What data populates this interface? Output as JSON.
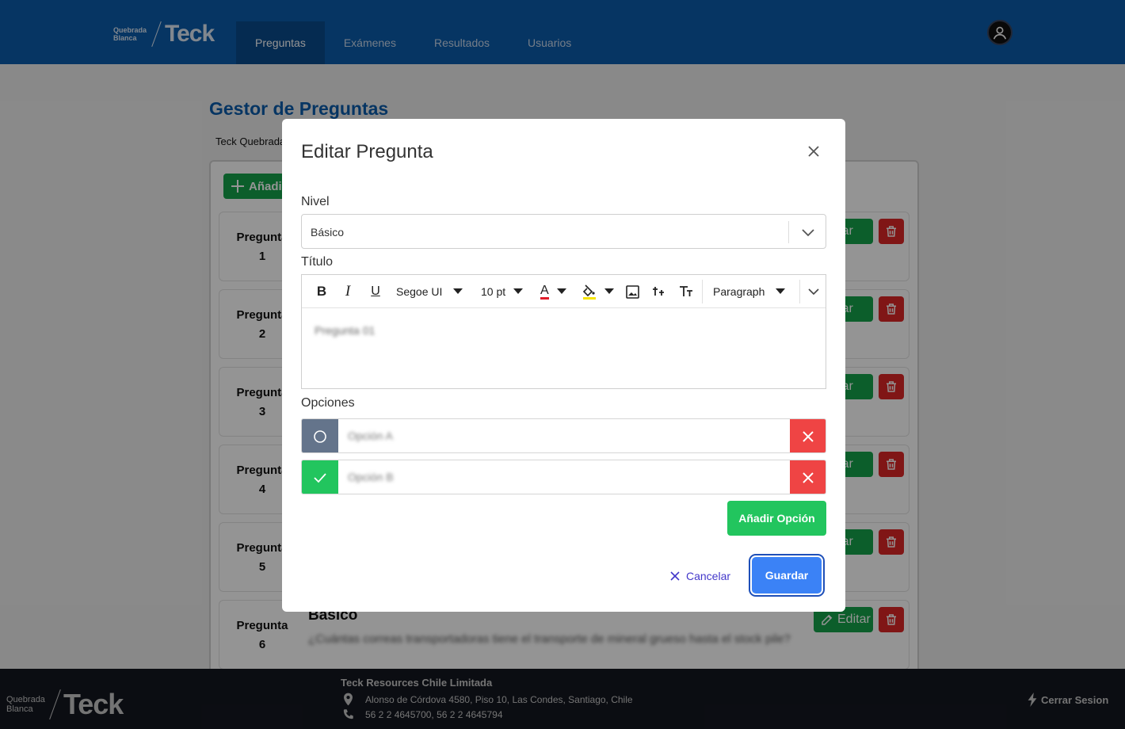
{
  "nav": {
    "brand_small_1": "Quebrada",
    "brand_small_2": "Blanca",
    "brand_name": "Teck",
    "tabs": [
      {
        "label": "Preguntas"
      },
      {
        "label": "Exámenes"
      },
      {
        "label": "Resultados"
      },
      {
        "label": "Usuarios"
      }
    ]
  },
  "page": {
    "title": "Gestor de Preguntas",
    "org_label": "Teck Quebrada",
    "add_button": "Añadir",
    "question_label": "Pregunta",
    "edit_label": "Editar",
    "questions": [
      {
        "num": "1"
      },
      {
        "num": "2"
      },
      {
        "num": "3"
      },
      {
        "num": "4"
      },
      {
        "num": "5"
      },
      {
        "num": "6",
        "level": "Básico",
        "text": "¿Cuántas correas transportadoras tiene el transporte de mineral grueso hasta el stock pile?"
      }
    ]
  },
  "modal": {
    "title": "Editar Pregunta",
    "nivel_label": "Nivel",
    "nivel_value": "Básico",
    "titulo_label": "Título",
    "toolbar": {
      "bold": "B",
      "italic": "I",
      "underline": "U",
      "font": "Segoe UI",
      "size": "10 pt",
      "font_color": "A",
      "format": "Paragraph"
    },
    "editor_content": "Pregunta 01",
    "opciones_label": "Opciones",
    "options": [
      {
        "text": "Opción A",
        "correct": false
      },
      {
        "text": "Opción B",
        "correct": true
      }
    ],
    "add_option": "Añadir Opción",
    "cancel": "Cancelar",
    "save": "Guardar"
  },
  "footer": {
    "brand_small_1": "Quebrada",
    "brand_small_2": "Blanca",
    "brand_name": "Teck",
    "company": "Teck Resources Chile Limitada",
    "address": "Alonso de Córdova 4580, Piso 10, Las Condes, Santiago, Chile",
    "phones": "56 2 2 4645700, 56 2 2 4645794",
    "logout": "Cerrar Sesion"
  },
  "colors": {
    "nav_bg": "#0b5cab",
    "success": "#16a34a",
    "danger": "#dc2626",
    "primary": "#3b82f6",
    "footer_bg": "#141720"
  }
}
